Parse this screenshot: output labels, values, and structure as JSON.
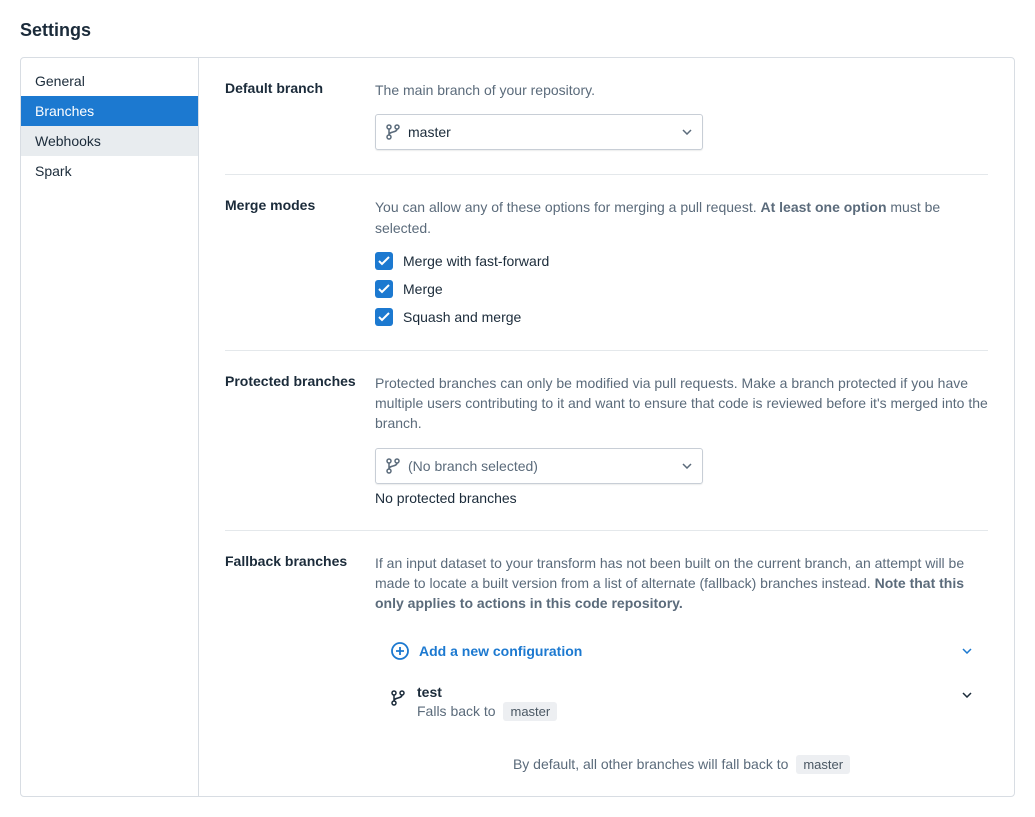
{
  "page": {
    "title": "Settings"
  },
  "sidebar": {
    "items": [
      {
        "label": "General"
      },
      {
        "label": "Branches"
      },
      {
        "label": "Webhooks"
      },
      {
        "label": "Spark"
      }
    ]
  },
  "sections": {
    "default_branch": {
      "label": "Default branch",
      "desc": "The main branch of your repository.",
      "selected": "master"
    },
    "merge_modes": {
      "label": "Merge modes",
      "desc_pre": "You can allow any of these options for merging a pull request. ",
      "desc_bold": "At least one option",
      "desc_post": " must be selected.",
      "options": [
        {
          "label": "Merge with fast-forward",
          "checked": true
        },
        {
          "label": "Merge",
          "checked": true
        },
        {
          "label": "Squash and merge",
          "checked": true
        }
      ]
    },
    "protected": {
      "label": "Protected branches",
      "desc": "Protected branches can only be modified via pull requests. Make a branch protected if you have multiple users contributing to it and want to ensure that code is reviewed before it's merged into the branch.",
      "placeholder": "(No branch selected)",
      "empty": "No protected branches"
    },
    "fallback": {
      "label": "Fallback branches",
      "desc_pre": "If an input dataset to your transform has not been built on the current branch, an attempt will be made to locate a built version from a list of alternate (fallback) branches instead. ",
      "desc_bold": "Note that this only applies to actions in this code repository.",
      "add_label": "Add a new configuration",
      "items": [
        {
          "name": "test",
          "falls_back_label": "Falls back to",
          "falls_back_to": "master"
        }
      ],
      "default_note_pre": "By default, all other branches will fall back to",
      "default_note_branch": "master"
    }
  }
}
